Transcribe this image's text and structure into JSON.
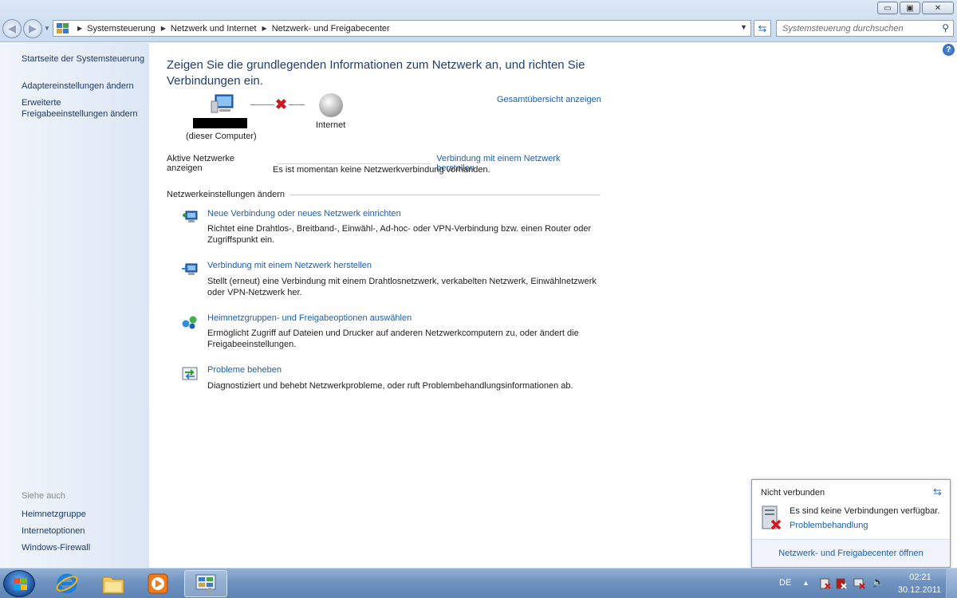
{
  "window": {
    "controls": {
      "minimize": "▭",
      "maximize": "▣",
      "close": "✕"
    }
  },
  "address_bar": {
    "breadcrumbs": [
      "Systemsteuerung",
      "Netzwerk und Internet",
      "Netzwerk- und Freigabecenter"
    ],
    "search_placeholder": "Systemsteuerung durchsuchen"
  },
  "sidebar": {
    "links": [
      "Startseite der Systemsteuerung",
      "Adaptereinstellungen ändern",
      "Erweiterte Freigabeeinstellungen ändern"
    ],
    "see_also_label": "Siehe auch",
    "see_also": [
      "Heimnetzgruppe",
      "Internetoptionen",
      "Windows-Firewall"
    ]
  },
  "main": {
    "heading": "Zeigen Sie die grundlegenden Informationen zum Netzwerk an, und richten Sie Verbindungen ein.",
    "full_map_link": "Gesamtübersicht anzeigen",
    "map": {
      "computer_label": "(dieser Computer)",
      "internet_label": "Internet"
    },
    "active_networks": {
      "label": "Aktive Netzwerke anzeigen",
      "connect_link": "Verbindung mit einem Netzwerk herstellen",
      "status": "Es ist momentan keine Netzwerkverbindung vorhanden."
    },
    "settings_label": "Netzwerkeinstellungen ändern",
    "tasks": [
      {
        "title": "Neue Verbindung oder neues Netzwerk einrichten",
        "desc": "Richtet eine Drahtlos-, Breitband-, Einwähl-, Ad-hoc- oder VPN-Verbindung bzw. einen Router oder Zugriffspunkt ein.",
        "icon": "new-connection-icon"
      },
      {
        "title": "Verbindung mit einem Netzwerk herstellen",
        "desc": "Stellt (erneut) eine Verbindung mit einem Drahtlosnetzwerk, verkabelten Netzwerk, Einwählnetzwerk oder VPN-Netzwerk her.",
        "icon": "connect-network-icon"
      },
      {
        "title": "Heimnetzgruppen- und Freigabeoptionen auswählen",
        "desc": "Ermöglicht Zugriff auf Dateien und Drucker auf anderen Netzwerkcomputern zu, oder ändert die Freigabeeinstellungen.",
        "icon": "homegroup-icon"
      },
      {
        "title": "Probleme beheben",
        "desc": "Diagnostiziert und behebt Netzwerkprobleme, oder ruft Problembehandlungsinformationen ab.",
        "icon": "troubleshoot-icon"
      }
    ]
  },
  "flyout": {
    "title": "Nicht verbunden",
    "message": "Es sind keine Verbindungen verfügbar.",
    "troubleshoot_link": "Problembehandlung",
    "footer_link": "Netzwerk- und Freigabecenter öffnen"
  },
  "taskbar": {
    "language": "DE",
    "time": "02:21",
    "date": "30.12.2011"
  },
  "colors": {
    "link": "#1f5fae",
    "heading": "#1e3d73",
    "sidebar_link": "#1b3a6a",
    "error_red": "#d4161b"
  }
}
